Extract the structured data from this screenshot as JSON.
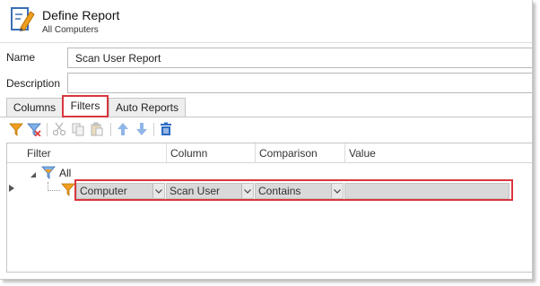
{
  "header": {
    "title": "Define Report",
    "subtitle": "All Computers"
  },
  "form": {
    "name_label": "Name",
    "name_value": "Scan User Report",
    "description_label": "Description",
    "description_value": ""
  },
  "tabs": [
    {
      "label": "Columns",
      "active": false
    },
    {
      "label": "Filters",
      "active": true
    },
    {
      "label": "Auto Reports",
      "active": false
    }
  ],
  "toolbar": {
    "icons": [
      "add-filter-icon",
      "remove-filter-icon",
      "cut-icon",
      "copy-icon",
      "paste-icon",
      "move-up-icon",
      "move-down-icon",
      "delete-icon"
    ]
  },
  "grid": {
    "columns": [
      "Filter",
      "Column",
      "Comparison",
      "Value"
    ],
    "root_node": "All",
    "filter_row": {
      "field": "Computer",
      "column": "Scan User",
      "comparison": "Contains",
      "value": ""
    }
  },
  "colors": {
    "highlight": "#d9363e",
    "filter_icon_orange": "#f0a020",
    "arrow_blue": "#3a7fd5",
    "delete_blue": "#2c6bc4"
  }
}
